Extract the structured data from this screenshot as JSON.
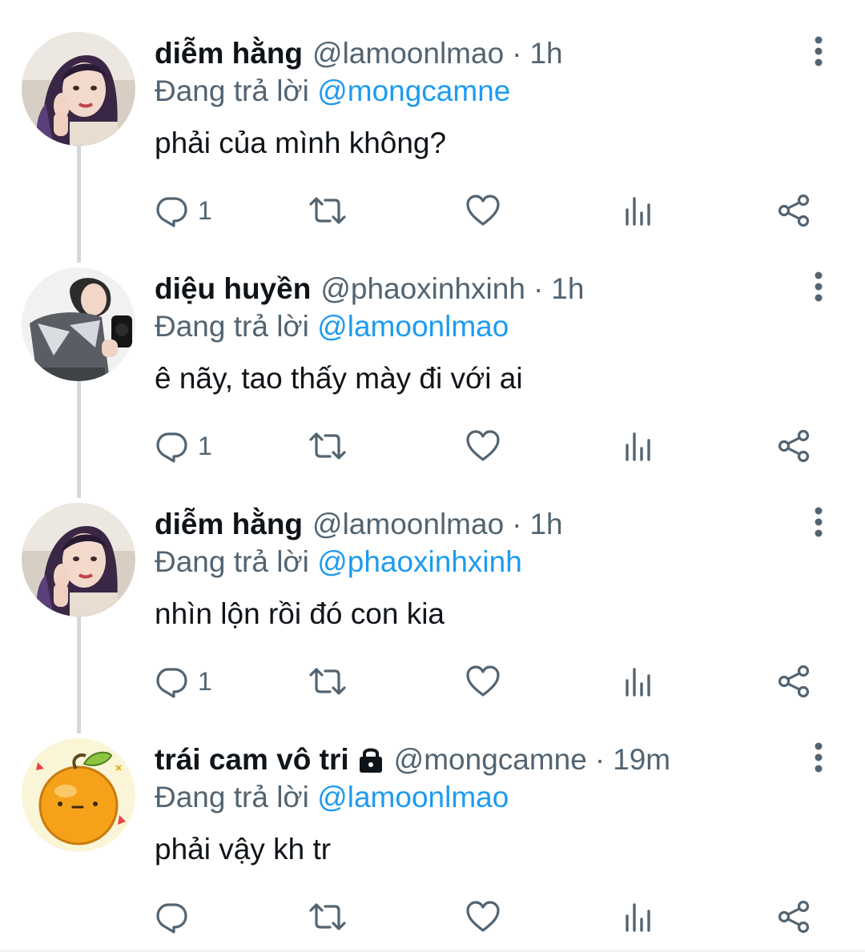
{
  "colors": {
    "link": "#1d9bf0",
    "secondary_text": "#536471",
    "primary_text": "#0f1419",
    "thread_line": "#cfd9de"
  },
  "tweets": [
    {
      "name": "diễm hằng",
      "handle": "@lamoonlmao",
      "time": "1h",
      "reply_prefix": "Đang trả lời ",
      "reply_mention": "@mongcamne",
      "text": "phải của mình không?",
      "reply_count": "1",
      "avatar": "girl-purple-hair-avatar",
      "locked": false
    },
    {
      "name": "diệu huyền",
      "handle": "@phaoxinhxinh",
      "time": "1h",
      "reply_prefix": "Đang trả lời ",
      "reply_mention": "@lamoonlmao",
      "text": "ê nãy, tao thấy mày đi với ai",
      "reply_count": "1",
      "avatar": "girl-camera-avatar",
      "locked": false
    },
    {
      "name": "diễm hằng",
      "handle": "@lamoonlmao",
      "time": "1h",
      "reply_prefix": "Đang trả lời ",
      "reply_mention": "@phaoxinhxinh",
      "text": "nhìn lộn rồi đó con kia",
      "reply_count": "1",
      "avatar": "girl-purple-hair-avatar",
      "locked": false
    },
    {
      "name": "trái cam vô tri",
      "handle": "@mongcamne",
      "time": "19m",
      "reply_prefix": "Đang trả lời ",
      "reply_mention": "@lamoonlmao",
      "text": "phải vậy kh tr",
      "reply_count": "",
      "avatar": "orange-cartoon-avatar",
      "locked": true
    }
  ],
  "separator": "·",
  "icons": [
    "reply-icon",
    "retweet-icon",
    "like-icon",
    "analytics-icon",
    "share-icon",
    "more-icon",
    "lock-icon"
  ]
}
